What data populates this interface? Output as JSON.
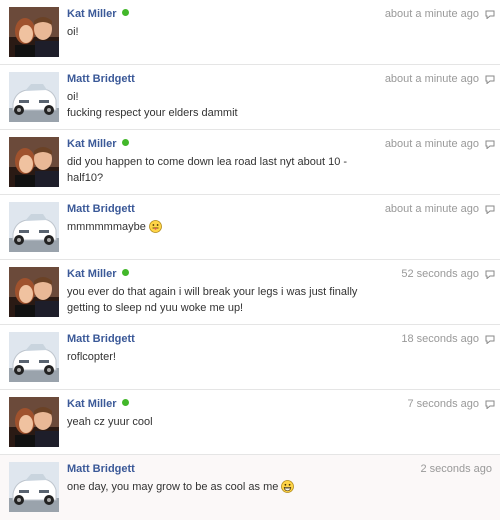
{
  "messages": [
    {
      "sender": "Kat Miller",
      "online": true,
      "avatar": "couple-photo",
      "time": "about a minute ago",
      "lines": [
        "oi!"
      ],
      "emoji": null
    },
    {
      "sender": "Matt Bridgett",
      "online": false,
      "avatar": "white-car-photo",
      "time": "about a minute ago",
      "lines": [
        "oi!",
        "fucking respect your elders dammit"
      ],
      "emoji": null
    },
    {
      "sender": "Kat Miller",
      "online": true,
      "avatar": "couple-photo",
      "time": "about a minute ago",
      "lines": [
        "did you happen to come down lea road last nyt about 10 -",
        "half10?"
      ],
      "emoji": null
    },
    {
      "sender": "Matt Bridgett",
      "online": false,
      "avatar": "white-car-photo",
      "time": "about a minute ago",
      "lines": [
        "mmmmmmaybe"
      ],
      "emoji": "tongue-emoji"
    },
    {
      "sender": "Kat Miller",
      "online": true,
      "avatar": "couple-photo",
      "time": "52 seconds ago",
      "lines": [
        "you ever do that again i will break your legs i was just finally",
        "getting to sleep nd yuu woke me up!"
      ],
      "emoji": null
    },
    {
      "sender": "Matt Bridgett",
      "online": false,
      "avatar": "white-car-photo",
      "time": "18 seconds ago",
      "lines": [
        "roflcopter!"
      ],
      "emoji": null
    },
    {
      "sender": "Kat Miller",
      "online": true,
      "avatar": "couple-photo",
      "time": "7 seconds ago",
      "lines": [
        "yeah cz yuur cool"
      ],
      "emoji": null
    },
    {
      "sender": "Matt Bridgett",
      "online": false,
      "avatar": "white-car-photo",
      "time": "2 seconds ago",
      "lines": [
        "one day, you may grow to be as cool as me"
      ],
      "emoji": "grin-emoji"
    }
  ],
  "colors": {
    "link": "#3b5998",
    "online": "#42b72a",
    "timestamp": "#999999"
  },
  "icons": {
    "reply": "reply-icon"
  }
}
